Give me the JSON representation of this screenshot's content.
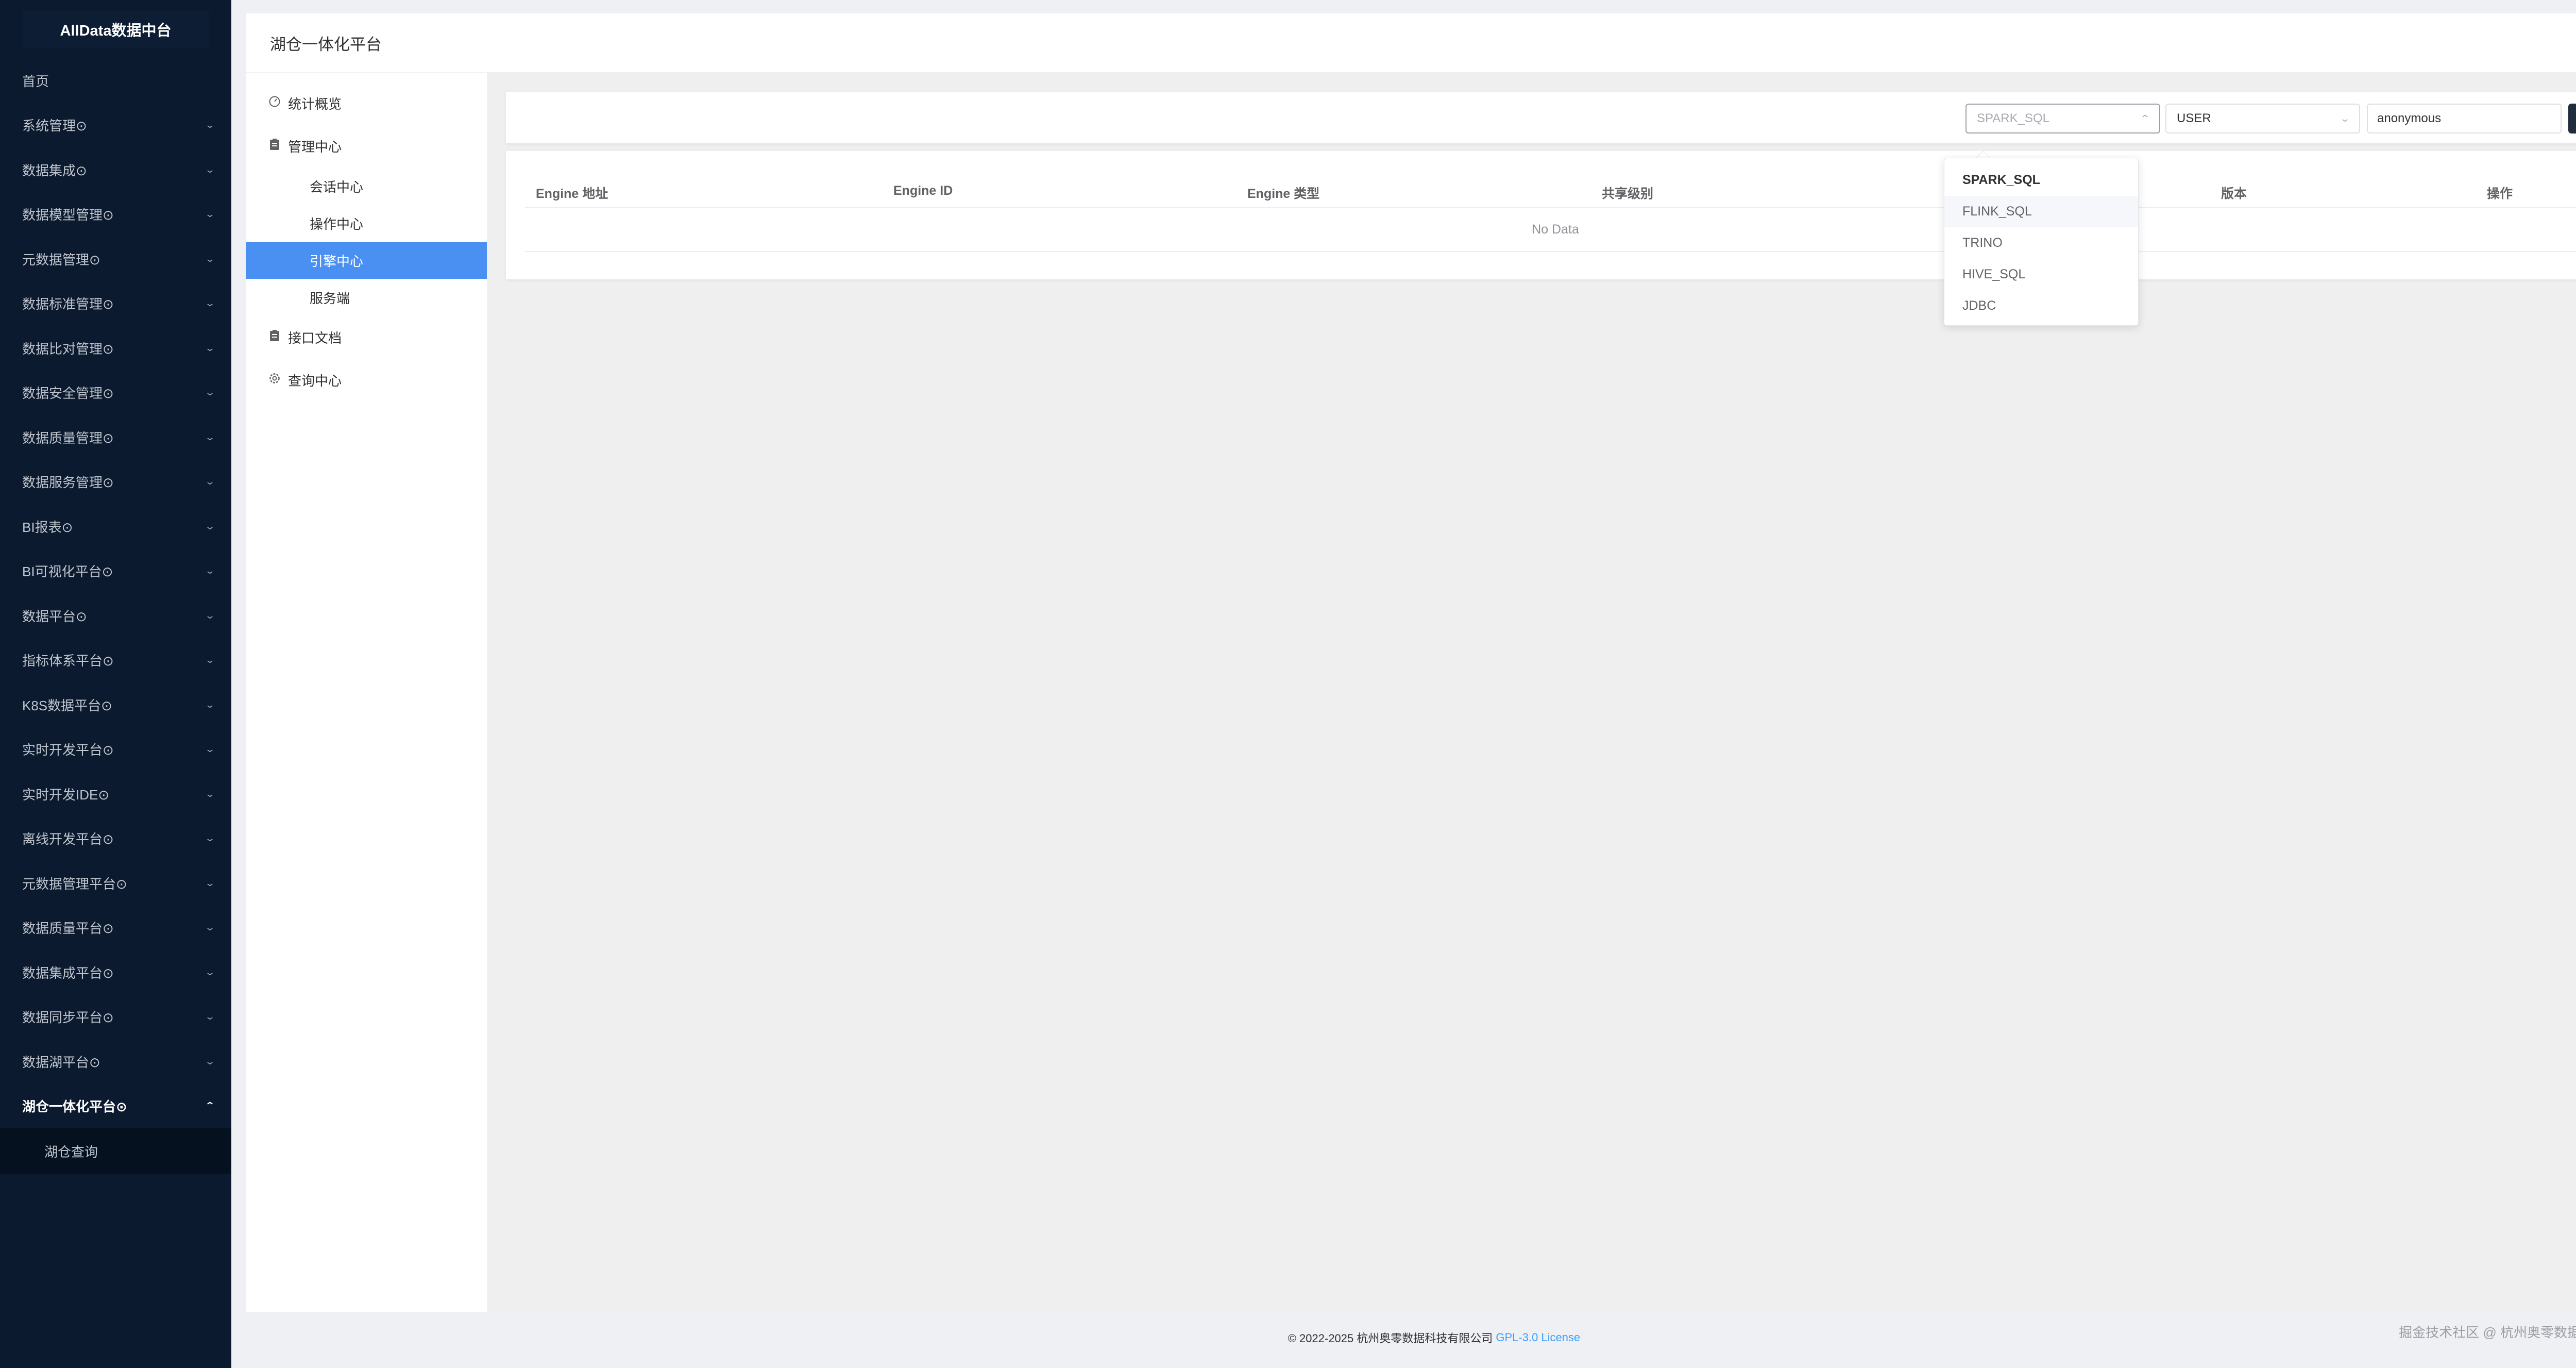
{
  "sidebar": {
    "logo": "AllData数据中台",
    "items": [
      {
        "label": "首页",
        "chevron": false
      },
      {
        "label": "系统管理⊙",
        "chevron": true
      },
      {
        "label": "数据集成⊙",
        "chevron": true
      },
      {
        "label": "数据模型管理⊙",
        "chevron": true
      },
      {
        "label": "元数据管理⊙",
        "chevron": true
      },
      {
        "label": "数据标准管理⊙",
        "chevron": true
      },
      {
        "label": "数据比对管理⊙",
        "chevron": true
      },
      {
        "label": "数据安全管理⊙",
        "chevron": true
      },
      {
        "label": "数据质量管理⊙",
        "chevron": true
      },
      {
        "label": "数据服务管理⊙",
        "chevron": true
      },
      {
        "label": "BI报表⊙",
        "chevron": true
      },
      {
        "label": "BI可视化平台⊙",
        "chevron": true
      },
      {
        "label": "数据平台⊙",
        "chevron": true
      },
      {
        "label": "指标体系平台⊙",
        "chevron": true
      },
      {
        "label": "K8S数据平台⊙",
        "chevron": true
      },
      {
        "label": "实时开发平台⊙",
        "chevron": true
      },
      {
        "label": "实时开发IDE⊙",
        "chevron": true
      },
      {
        "label": "离线开发平台⊙",
        "chevron": true
      },
      {
        "label": "元数据管理平台⊙",
        "chevron": true
      },
      {
        "label": "数据质量平台⊙",
        "chevron": true
      },
      {
        "label": "数据集成平台⊙",
        "chevron": true
      },
      {
        "label": "数据同步平台⊙",
        "chevron": true
      },
      {
        "label": "数据湖平台⊙",
        "chevron": true
      },
      {
        "label": "湖仓一体化平台⊙",
        "chevron": true,
        "active": true
      }
    ],
    "submenu": {
      "label": "湖仓查询"
    },
    "chevron_down": "⌄",
    "chevron_up": "⌃"
  },
  "header": {
    "title": "湖仓一体化平台"
  },
  "subnav": {
    "stats": {
      "label": "统计概览",
      "icon": "dashboard-icon"
    },
    "manage": {
      "label": "管理中心",
      "icon": "clipboard-icon"
    },
    "leaves": [
      "会话中心",
      "操作中心",
      "引擎中心",
      "服务端"
    ],
    "active_leaf": "引擎中心",
    "api_docs": {
      "label": "接口文档",
      "icon": "clipboard-icon"
    },
    "query": {
      "label": "查询中心",
      "icon": "gear-icon"
    }
  },
  "toolbar": {
    "engine_select": {
      "placeholder": "SPARK_SQL",
      "open": true
    },
    "share_level_select": {
      "value": "USER"
    },
    "user_input": {
      "value": "anonymous"
    },
    "search_icon": "search-icon"
  },
  "table": {
    "columns": [
      "Engine 地址",
      "Engine ID",
      "Engine 类型",
      "共享级别",
      "版本",
      "操作"
    ],
    "empty_text": "No Data"
  },
  "dropdown": {
    "options": [
      "SPARK_SQL",
      "FLINK_SQL",
      "TRINO",
      "HIVE_SQL",
      "JDBC"
    ],
    "selected": "SPARK_SQL",
    "hovered": "FLINK_SQL"
  },
  "footer": {
    "copyright": "© 2022-2025 杭州奥零数据科技有限公司",
    "license_link": "GPL-3.0 License",
    "watermark": "掘金技术社区 @ 杭州奥零数据科技"
  },
  "colors": {
    "sidebar_bg": "#0b1a2e",
    "active_blue": "#4a8ff2",
    "search_button": "#1f2d3d",
    "link": "#409eff"
  }
}
